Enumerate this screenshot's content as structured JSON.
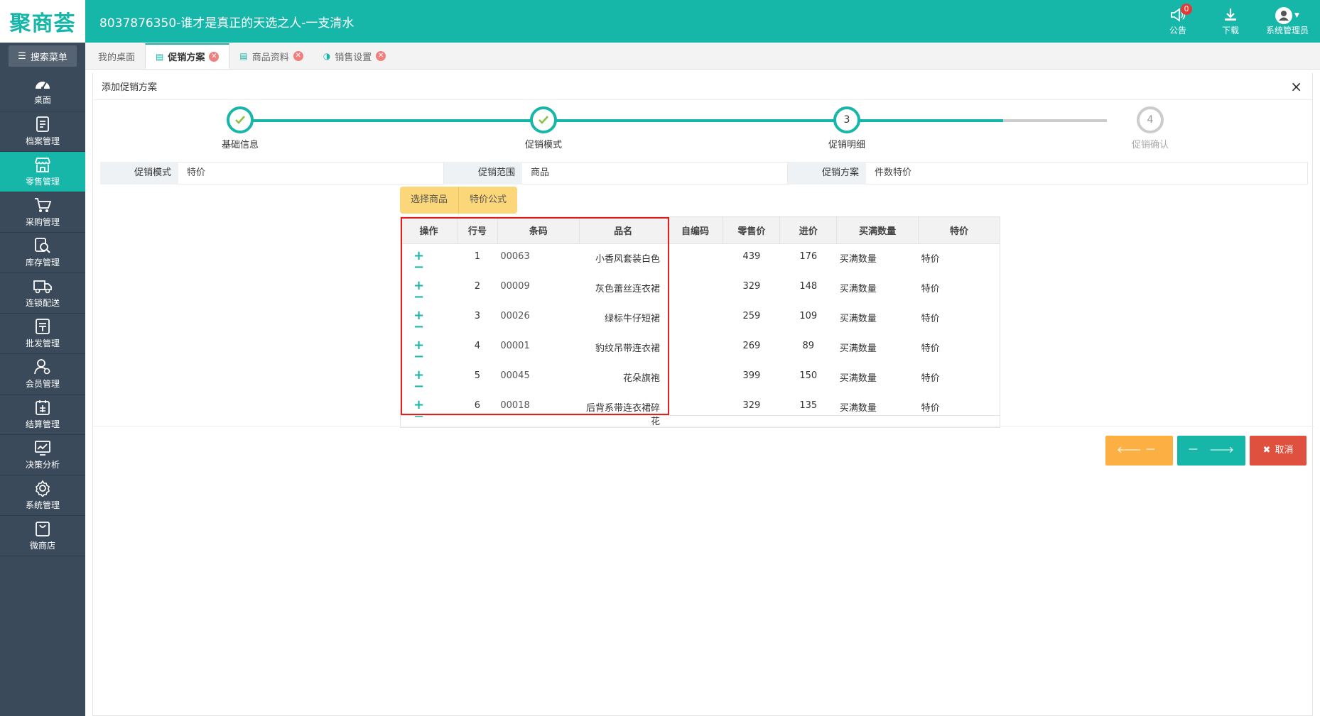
{
  "app": {
    "logo": "聚商荟",
    "title": "8037876350-谁才是真正的天选之人-一支清水"
  },
  "top_actions": [
    {
      "label": "公告",
      "icon": "megaphone-icon",
      "badge": "0"
    },
    {
      "label": "下载",
      "icon": "download-icon"
    },
    {
      "label": "系统管理员",
      "icon": "avatar"
    }
  ],
  "sidebar": {
    "search_label": "搜索菜单",
    "items": [
      {
        "label": "桌面",
        "icon": "dashboard-icon"
      },
      {
        "label": "档案管理",
        "icon": "file-icon"
      },
      {
        "label": "零售管理",
        "icon": "store-icon",
        "active": true
      },
      {
        "label": "采购管理",
        "icon": "cart-icon"
      },
      {
        "label": "库存管理",
        "icon": "inventory-search-icon"
      },
      {
        "label": "连锁配送",
        "icon": "truck-icon"
      },
      {
        "label": "批发管理",
        "icon": "wholesale-icon"
      },
      {
        "label": "会员管理",
        "icon": "member-icon"
      },
      {
        "label": "结算管理",
        "icon": "settlement-icon"
      },
      {
        "label": "决策分析",
        "icon": "chart-icon"
      },
      {
        "label": "系统管理",
        "icon": "gear-icon"
      },
      {
        "label": "微商店",
        "icon": "shop-bag-icon"
      }
    ]
  },
  "tabs": [
    {
      "label": "我的桌面",
      "active": false,
      "closable": false
    },
    {
      "label": "促销方案",
      "active": true,
      "closable": true
    },
    {
      "label": "商品资料",
      "active": false,
      "closable": true
    },
    {
      "label": "销售设置",
      "active": false,
      "closable": true
    }
  ],
  "panel": {
    "title": "添加促销方案",
    "close": "×"
  },
  "steps": [
    {
      "number": "1",
      "label": "基础信息",
      "state": "done"
    },
    {
      "number": "2",
      "label": "促销模式",
      "state": "done"
    },
    {
      "number": "3",
      "label": "促销明细",
      "state": "current"
    },
    {
      "number": "4",
      "label": "促销确认",
      "state": "pending"
    }
  ],
  "info": {
    "mode_label": "促销模式",
    "mode_value": "特价",
    "scope_label": "促销范围",
    "scope_value": "商品",
    "plan_label": "促销方案",
    "plan_value": "件数特价"
  },
  "buttons": {
    "select_goods": "选择商品",
    "price_formula": "特价公式",
    "prev": "上一步",
    "next": "下一步",
    "cancel": "取消"
  },
  "table": {
    "columns": [
      "操作",
      "行号",
      "条码",
      "品名",
      "自编码",
      "零售价",
      "进价",
      "买满数量",
      "特价"
    ],
    "qty_placeholder": "买满数量",
    "price_placeholder": "特价",
    "rows": [
      {
        "no": "1",
        "barcode": "00063",
        "name": "小香风套装白色",
        "code": "",
        "retail": "439",
        "cost": "176"
      },
      {
        "no": "2",
        "barcode": "00009",
        "name": "灰色蕾丝连衣裙",
        "code": "",
        "retail": "329",
        "cost": "148"
      },
      {
        "no": "3",
        "barcode": "00026",
        "name": "绿标牛仔短裙",
        "code": "",
        "retail": "259",
        "cost": "109"
      },
      {
        "no": "4",
        "barcode": "00001",
        "name": "豹纹吊带连衣裙",
        "code": "",
        "retail": "269",
        "cost": "89"
      },
      {
        "no": "5",
        "barcode": "00045",
        "name": "花朵旗袍",
        "code": "",
        "retail": "399",
        "cost": "150"
      },
      {
        "no": "6",
        "barcode": "00018",
        "name": "后背系带连衣裙碎花",
        "code": "",
        "retail": "329",
        "cost": "135"
      }
    ]
  },
  "colors": {
    "primary": "#16b6a9",
    "sidebar": "#3a4a5a",
    "warning": "#fcb043",
    "danger": "#e0503f",
    "highlight": "#e02020"
  }
}
